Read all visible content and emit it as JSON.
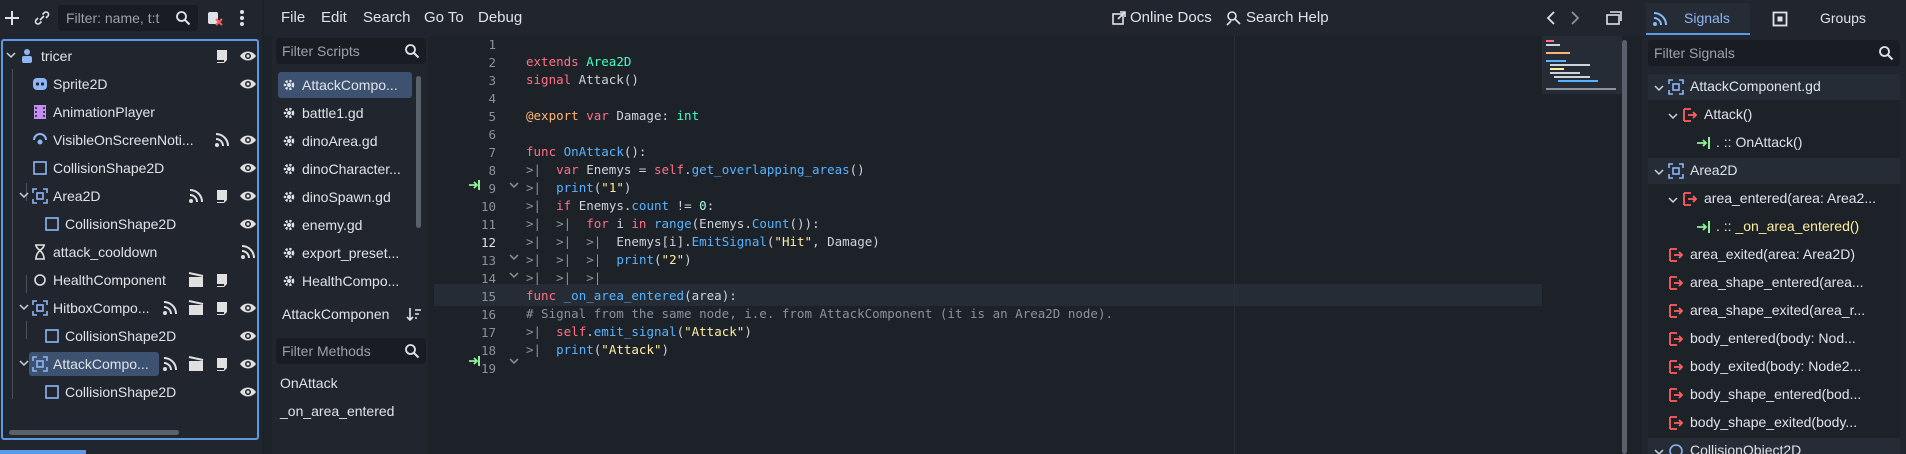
{
  "scene": {
    "filter_placeholder": "Filter: name, t:t",
    "nodes": [
      {
        "label": "tricer"
      },
      {
        "label": "Sprite2D"
      },
      {
        "label": "AnimationPlayer"
      },
      {
        "label": "VisibleOnScreenNoti..."
      },
      {
        "label": "CollisionShape2D"
      },
      {
        "label": "Area2D"
      },
      {
        "label": "CollisionShape2D"
      },
      {
        "label": "attack_cooldown"
      },
      {
        "label": "HealthComponent"
      },
      {
        "label": "HitboxCompo..."
      },
      {
        "label": "CollisionShape2D"
      },
      {
        "label": "AttackCompo..."
      },
      {
        "label": "CollisionShape2D"
      }
    ]
  },
  "menubar": {
    "file": "File",
    "edit": "Edit",
    "search": "Search",
    "goto": "Go To",
    "debug": "Debug",
    "online_docs": "Online Docs",
    "search_help": "Search Help"
  },
  "scripts": {
    "filter_placeholder": "Filter Scripts",
    "items": [
      "AttackCompo...",
      "battle1.gd",
      "dinoArea.gd",
      "dinoCharacter...",
      "dinoSpawn.gd",
      "enemy.gd",
      "export_preset...",
      "HealthCompo..."
    ],
    "current_script": "AttackComponen",
    "methods_placeholder": "Filter Methods",
    "methods": [
      "OnAttack",
      "_on_area_entered"
    ]
  },
  "editor": {
    "line_numbers": [
      "1",
      "2",
      "3",
      "4",
      "5",
      "6",
      "7",
      "8",
      "9",
      "10",
      "11",
      "12",
      "13",
      "14",
      "15",
      "16",
      "17",
      "18",
      "19"
    ]
  },
  "signals": {
    "tab_signals": "Signals",
    "tab_groups": "Groups",
    "filter_placeholder": "Filter Signals",
    "items": [
      "AttackComponent.gd",
      "Attack()",
      ". :: OnAttack()",
      "Area2D",
      "area_entered(area: Area2...",
      ". :: _on_area_entered()",
      "area_exited(area: Area2D)",
      "area_shape_entered(area...",
      "area_shape_exited(area_r...",
      "body_entered(body: Nod...",
      "body_exited(body: Node2...",
      "body_shape_entered(bod...",
      "body_shape_exited(body...",
      "CollisionObject2D"
    ]
  },
  "colors": {
    "accent": "#5c9ae6",
    "bg": "#1d2229",
    "panel": "#21262e",
    "selection": "#3d5270"
  }
}
